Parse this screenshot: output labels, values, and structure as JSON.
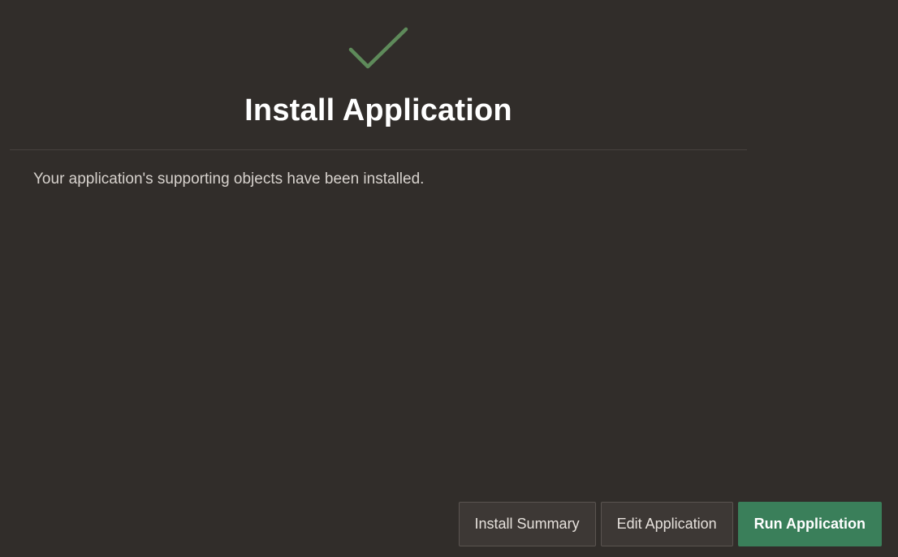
{
  "dialog": {
    "title": "Install Application",
    "icon": "checkmark-icon",
    "message": "Your application's supporting objects have been installed."
  },
  "buttons": {
    "install_summary": "Install Summary",
    "edit_application": "Edit Application",
    "run_application": "Run Application"
  },
  "colors": {
    "background": "#312d2a",
    "success_check": "#5e8a5a",
    "primary_button": "#3a7f5a",
    "secondary_button": "#3d3835"
  }
}
